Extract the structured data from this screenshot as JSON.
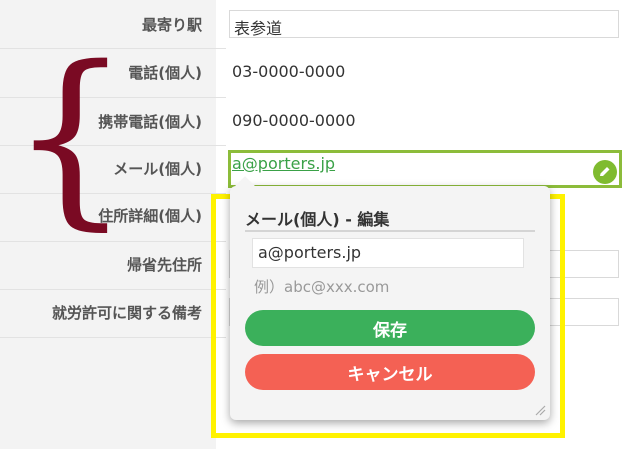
{
  "form": {
    "rows": [
      {
        "label": "最寄り駅",
        "value": "表参道"
      },
      {
        "label": "電話(個人)",
        "value": "03-0000-0000"
      },
      {
        "label": "携帯電話(個人)",
        "value": "090-0000-0000"
      },
      {
        "label": "メール(個人)",
        "value": "a@porters.jp"
      },
      {
        "label": "住所詳細(個人)",
        "value": ""
      },
      {
        "label": "帰省先住所",
        "value": ""
      },
      {
        "label": "就労許可に関する備考",
        "value": ""
      }
    ]
  },
  "annotation": {
    "brace": "{",
    "brace_color": "#7a0a23",
    "highlight_color": "#fff200"
  },
  "popup": {
    "title": "メール(個人) - 編集",
    "input_value": "a@porters.jp",
    "hint": "例）abc@xxx.com",
    "save_label": "保存",
    "cancel_label": "キャンセル",
    "save_color": "#3bb05b",
    "cancel_color": "#f46154"
  },
  "icons": {
    "edit": "pencil-icon",
    "resize": "resize-grip-icon"
  }
}
